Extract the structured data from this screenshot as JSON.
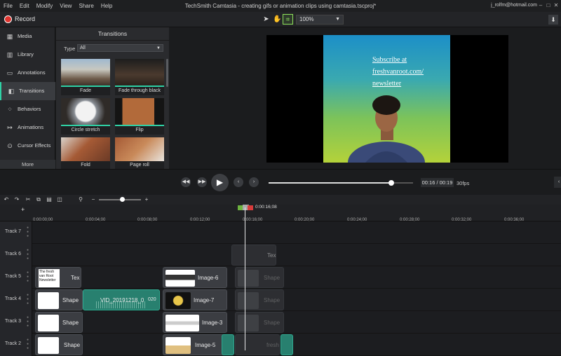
{
  "menu": [
    "File",
    "Edit",
    "Modify",
    "View",
    "Share",
    "Help"
  ],
  "app_title": "TechSmith Camtasia - creating gifs or animation clips using camtasia.tscproj*",
  "account": "j_rolfm@hotmail.com",
  "window_controls": {
    "minimize": "–",
    "maximize": "□",
    "close": "✕"
  },
  "toolbar": {
    "record_label": "Record",
    "zoom": "100%",
    "tools": [
      "pointer-icon",
      "hand-icon",
      "crop-icon"
    ]
  },
  "leftnav": {
    "items": [
      {
        "label": "Media",
        "icon": "media-icon"
      },
      {
        "label": "Library",
        "icon": "library-icon"
      },
      {
        "label": "Annotations",
        "icon": "annotations-icon"
      },
      {
        "label": "Transitions",
        "icon": "transitions-icon",
        "active": true
      },
      {
        "label": "Behaviors",
        "icon": "behaviors-icon"
      },
      {
        "label": "Animations",
        "icon": "animations-icon"
      },
      {
        "label": "Cursor Effects",
        "icon": "cursor-effects-icon"
      }
    ],
    "more_label": "More"
  },
  "transitions_panel": {
    "title": "Transitions",
    "type_label": "Type",
    "type_value": "All",
    "items": [
      {
        "label": "Fade"
      },
      {
        "label": "Fade through black"
      },
      {
        "label": "Circle stretch"
      },
      {
        "label": "Flip"
      },
      {
        "label": "Fold"
      },
      {
        "label": "Page roll"
      }
    ]
  },
  "preview": {
    "line1": "Subscribe at",
    "line2": "freshvanroot.com/",
    "line3": "newsletter"
  },
  "playback": {
    "time": "00:16 / 00:19",
    "fps": "30fps",
    "progress": 0.85
  },
  "timeline": {
    "zoom_level": 0.55,
    "playhead_label": "0:00:16;08",
    "ruler": [
      "0:00:00;00",
      "0:00:04;00",
      "0:00:08;00",
      "0:00:12;00",
      "0:00:16;00",
      "0:00:20;00",
      "0:00:24;00",
      "0:00:28;00",
      "0:00:32;00",
      "0:00:36;00"
    ],
    "tracks": [
      {
        "name": "Track 7"
      },
      {
        "name": "Track 6"
      },
      {
        "name": "Track 5"
      },
      {
        "name": "Track 4"
      },
      {
        "name": "Track 3"
      },
      {
        "name": "Track 2"
      }
    ],
    "clips": {
      "t6_text": "Tex",
      "t5_note": "The fresh van Root Newsletter",
      "t5_text": "Tex",
      "t5_image": "Image-6",
      "t5_ghost": "Shape",
      "t4_shape": "Shape",
      "t4_media": "VID_20191218_0",
      "t4_media_end": "020",
      "t4_image": "Image-7",
      "t4_ghost": "Shape",
      "t3_shape": "Shape",
      "t3_image": "Image-3",
      "t3_ghost": "Shape",
      "t2_shape": "Shape",
      "t2_image": "Image-5",
      "t2_ghost": "fresh"
    }
  }
}
